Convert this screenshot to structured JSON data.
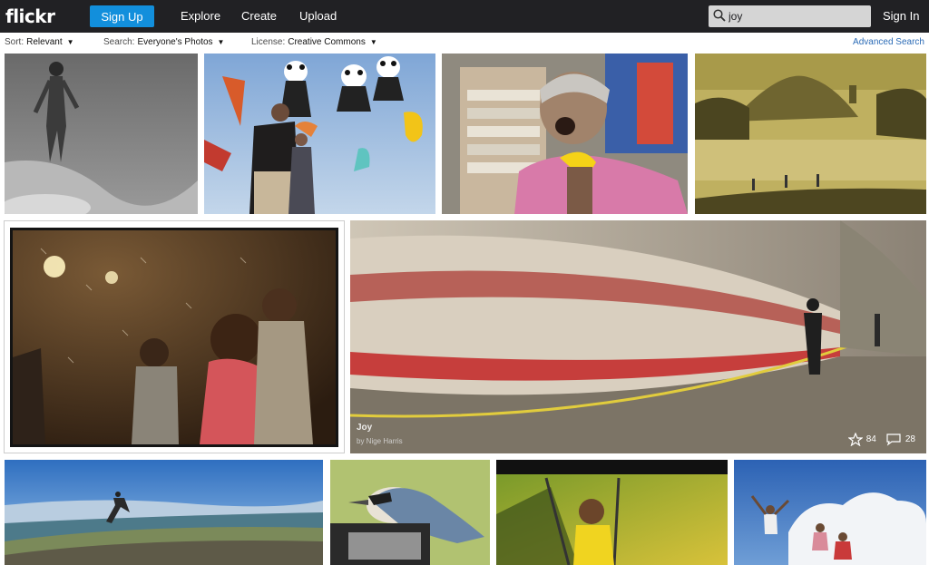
{
  "header": {
    "logo": "flickr",
    "signup_label": "Sign Up",
    "nav": [
      "Explore",
      "Create",
      "Upload"
    ],
    "search_value": "joy",
    "signin_label": "Sign In"
  },
  "filters": {
    "sort_label": "Sort:",
    "sort_value": "Relevant",
    "search_label": "Search:",
    "search_value": "Everyone's Photos",
    "license_label": "License:",
    "license_value": "Creative Commons",
    "advanced": "Advanced Search"
  },
  "featured": {
    "title": "Joy",
    "author": "by Nige Harris",
    "faves": "84",
    "comments": "28"
  }
}
